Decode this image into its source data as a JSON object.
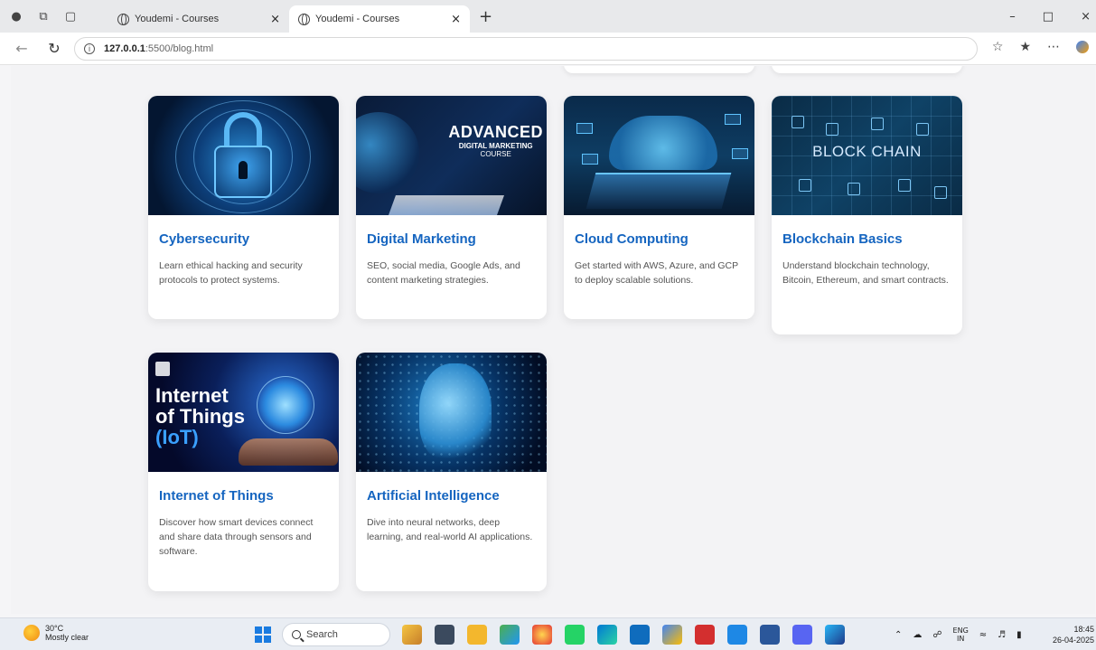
{
  "browser": {
    "tabs": [
      {
        "title": "Youdemi - Courses",
        "active": false
      },
      {
        "title": "Youdemi - Courses",
        "active": true
      }
    ],
    "new_tab_symbol": "+",
    "url_host": "127.0.0.1",
    "url_path": ":5500/blog.html"
  },
  "icons": {
    "profile": "profile-icon",
    "workspaces": "workspaces-icon",
    "tab_actions": "tab-actions-icon",
    "back": "back-arrow-icon",
    "reload": "reload-icon",
    "info": "info-icon",
    "favorite": "star-icon",
    "collections": "favorites-list-icon",
    "more": "more-icon"
  },
  "courses": [
    {
      "title": "Cybersecurity",
      "desc": "Learn ethical hacking and security protocols to protect systems."
    },
    {
      "title": "Digital Marketing",
      "desc": "SEO, social media, Google Ads, and content marketing strategies.",
      "banner": {
        "line1": "ADVANCED",
        "line2": "DIGITAL MARKETING",
        "line3": "COURSE"
      }
    },
    {
      "title": "Cloud Computing",
      "desc": "Get started with AWS, Azure, and GCP to deploy scalable solutions."
    },
    {
      "title": "Blockchain Basics",
      "desc": "Understand blockchain technology, Bitcoin, Ethereum, and smart contracts.",
      "banner": {
        "line1": "BLOCK CHAIN"
      }
    },
    {
      "title": "Internet of Things",
      "desc": "Discover how smart devices connect and share data through sensors and software.",
      "banner": {
        "line1": "Internet",
        "line2": "of Things",
        "line3": "(IoT)"
      }
    },
    {
      "title": "Artificial Intelligence",
      "desc": "Dive into neural networks, deep learning, and real-world AI applications."
    }
  ],
  "taskbar": {
    "temperature": "30°C",
    "weather": "Mostly clear",
    "search_label": "Search",
    "lang_line1": "ENG",
    "lang_line2": "IN",
    "time": "18:45",
    "date": "26-04-2025"
  }
}
